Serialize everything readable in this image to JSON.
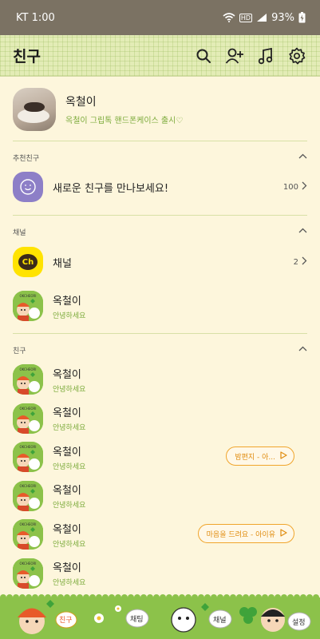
{
  "status_bar": {
    "carrier_time": "KT 1:00",
    "battery": "93%",
    "hd_label": "HD"
  },
  "header": {
    "title": "친구",
    "icons": [
      "search-icon",
      "add-friend-icon",
      "music-icon",
      "settings-icon"
    ]
  },
  "profile": {
    "name": "옥철이",
    "status_message": "옥철이 그립톡 핸드폰케이스 출시♡"
  },
  "sections": {
    "recommended": {
      "title": "추천친구",
      "item": {
        "label": "새로운 친구를 만나보세요!",
        "count": "100"
      }
    },
    "channel": {
      "title": "채널",
      "item": {
        "label": "채널",
        "count": "2",
        "logo_text": "Ch"
      },
      "friend": {
        "name": "옥철이",
        "message": "안녕하세요"
      }
    },
    "friends": {
      "title": "친구",
      "list": [
        {
          "name": "옥철이",
          "message": "안녕하세요",
          "music": ""
        },
        {
          "name": "옥철이",
          "message": "안녕하세요",
          "music": ""
        },
        {
          "name": "옥철이",
          "message": "안녕하세요",
          "music": "밤편지 - 아..."
        },
        {
          "name": "옥철이",
          "message": "안녕하세요",
          "music": ""
        },
        {
          "name": "옥철이",
          "message": "안녕하세요",
          "music": "마음을 드려요 - 아이유"
        },
        {
          "name": "옥철이",
          "message": "안녕하세요",
          "music": ""
        }
      ]
    }
  },
  "footer": {
    "bubbles": [
      "친구",
      "채팅",
      "채널",
      "설정"
    ]
  },
  "colors": {
    "accent_green": "#8cc24a",
    "status_text_green": "#7cab3b",
    "music_orange": "#f0a52c",
    "background": "#fdf6dc",
    "status_bar": "#7b7263"
  }
}
